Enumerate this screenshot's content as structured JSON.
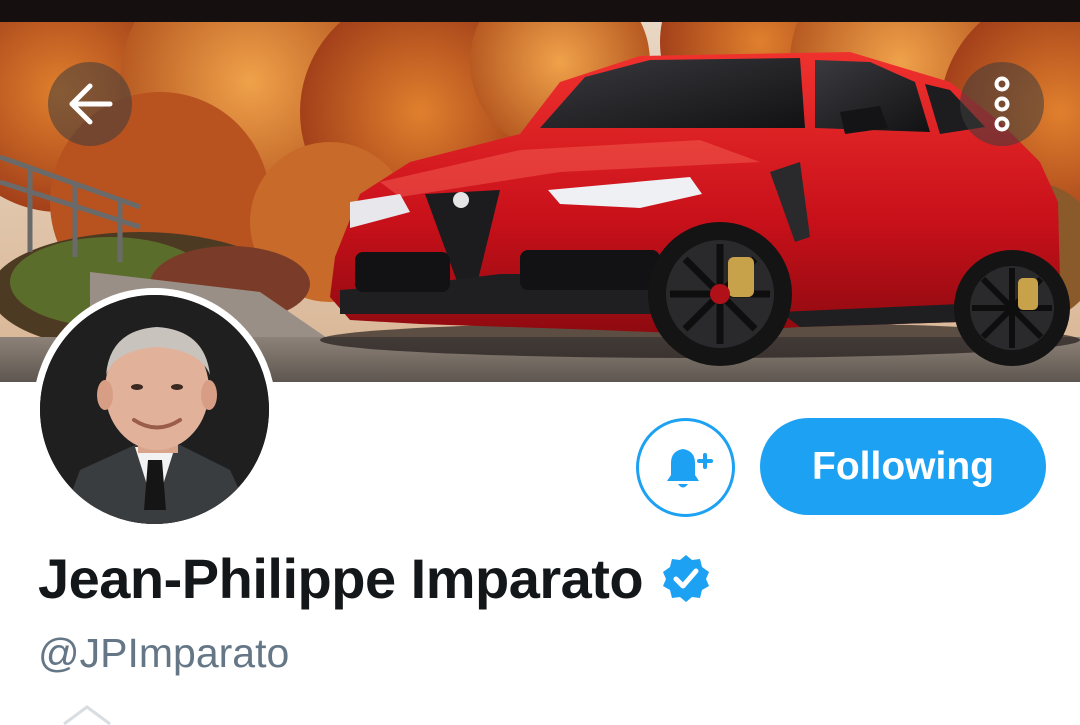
{
  "profile": {
    "display_name": "Jean-Philippe Imparato",
    "handle": "@JPImparato",
    "verified": true
  },
  "header": {
    "back_icon": "arrow-left-icon",
    "more_icon": "more-vertical-icon"
  },
  "actions": {
    "notify_icon": "bell-plus-icon",
    "following_label": "Following"
  },
  "colors": {
    "accent": "#1da1f2",
    "name_text": "#14171a",
    "handle_text": "#657786",
    "car_red": "#d4141c"
  }
}
